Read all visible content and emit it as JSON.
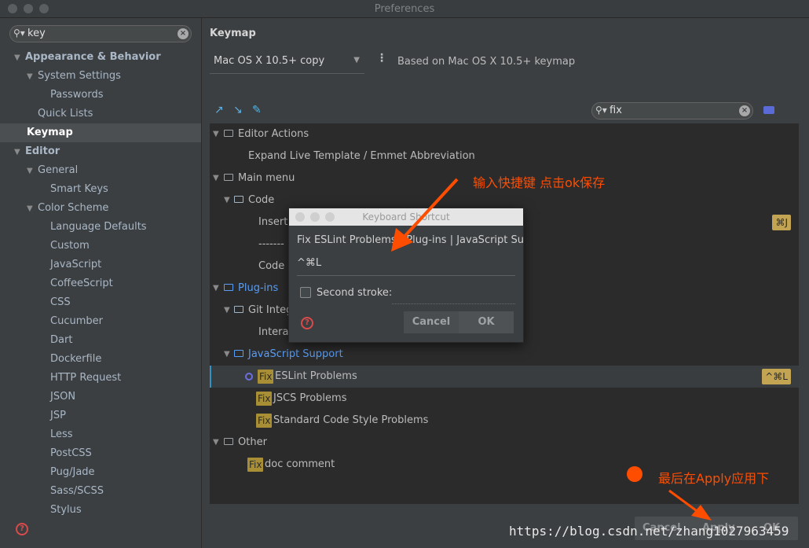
{
  "window": {
    "title": "Preferences"
  },
  "sidebar": {
    "search_value": "key",
    "items": [
      {
        "label": "Appearance & Behavior",
        "level": 0,
        "arrow": "v",
        "bold": true
      },
      {
        "label": "System Settings",
        "level": 1,
        "arrow": "v",
        "bold": false
      },
      {
        "label": "Passwords",
        "level": 2,
        "arrow": "",
        "bold": false
      },
      {
        "label": "Quick Lists",
        "level": 1,
        "arrow": "",
        "bold": false
      },
      {
        "label": "Keymap",
        "level": 0,
        "arrow": "",
        "bold": true,
        "selected": true
      },
      {
        "label": "Editor",
        "level": 0,
        "arrow": "v",
        "bold": true
      },
      {
        "label": "General",
        "level": 1,
        "arrow": "v",
        "bold": false
      },
      {
        "label": "Smart Keys",
        "level": 2,
        "arrow": "",
        "bold": false
      },
      {
        "label": "Color Scheme",
        "level": 1,
        "arrow": "v",
        "bold": false
      },
      {
        "label": "Language Defaults",
        "level": 2,
        "arrow": "",
        "bold": false
      },
      {
        "label": "Custom",
        "level": 2,
        "arrow": "",
        "bold": false
      },
      {
        "label": "JavaScript",
        "level": 2,
        "arrow": "",
        "bold": false
      },
      {
        "label": "CoffeeScript",
        "level": 2,
        "arrow": "",
        "bold": false
      },
      {
        "label": "CSS",
        "level": 2,
        "arrow": "",
        "bold": false
      },
      {
        "label": "Cucumber",
        "level": 2,
        "arrow": "",
        "bold": false
      },
      {
        "label": "Dart",
        "level": 2,
        "arrow": "",
        "bold": false
      },
      {
        "label": "Dockerfile",
        "level": 2,
        "arrow": "",
        "bold": false
      },
      {
        "label": "HTTP Request",
        "level": 2,
        "arrow": "",
        "bold": false
      },
      {
        "label": "JSON",
        "level": 2,
        "arrow": "",
        "bold": false
      },
      {
        "label": "JSP",
        "level": 2,
        "arrow": "",
        "bold": false
      },
      {
        "label": "Less",
        "level": 2,
        "arrow": "",
        "bold": false
      },
      {
        "label": "PostCSS",
        "level": 2,
        "arrow": "",
        "bold": false
      },
      {
        "label": "Pug/Jade",
        "level": 2,
        "arrow": "",
        "bold": false
      },
      {
        "label": "Sass/SCSS",
        "level": 2,
        "arrow": "",
        "bold": false
      },
      {
        "label": "Stylus",
        "level": 2,
        "arrow": "",
        "bold": false
      }
    ]
  },
  "main": {
    "heading": "Keymap",
    "keymap_value": "Mac OS X 10.5+ copy",
    "based_on": "Based on Mac OS X 10.5+ keymap",
    "filter_value": "fix"
  },
  "tree": {
    "editor_actions": "Editor Actions",
    "expand_live": "Expand Live Template / Emmet Abbreviation",
    "main_menu": "Main menu",
    "code": "Code",
    "insert_partial": "Insert",
    "dashes": "-------",
    "code_partial": "Code",
    "code_shortcut": "⌘J",
    "plugins": "Plug-ins",
    "git_partial": "Git Integ",
    "interac_partial": "Interac",
    "js_support": "JavaScript Support",
    "fix_badge": "Fix",
    "eslint": "ESLint Problems",
    "eslint_shortcut": "^⌘L",
    "jscs": "JSCS Problems",
    "standard": "Standard Code Style Problems",
    "other": "Other",
    "doc_comment": "doc comment"
  },
  "dialog": {
    "title": "Keyboard Shortcut",
    "subtitle": "Fix ESLint Problems | Plug-ins | JavaScript Support",
    "shortcut": "^⌘L",
    "second_stroke": "Second stroke:",
    "cancel": "Cancel",
    "ok": "OK"
  },
  "bottom": {
    "cancel": "Cancel",
    "apply": "Apply",
    "ok": "OK"
  },
  "annotations": {
    "top": "输入快捷键  点击ok保存",
    "bottom": "最后在Apply应用下"
  },
  "watermark": "https://blog.csdn.net/zhang1027963459",
  "colors": {
    "annotation": "#ff4d00",
    "fix_badge": "#a88f35",
    "shortcut": "#c2a453",
    "link_blue": "#589df6"
  }
}
